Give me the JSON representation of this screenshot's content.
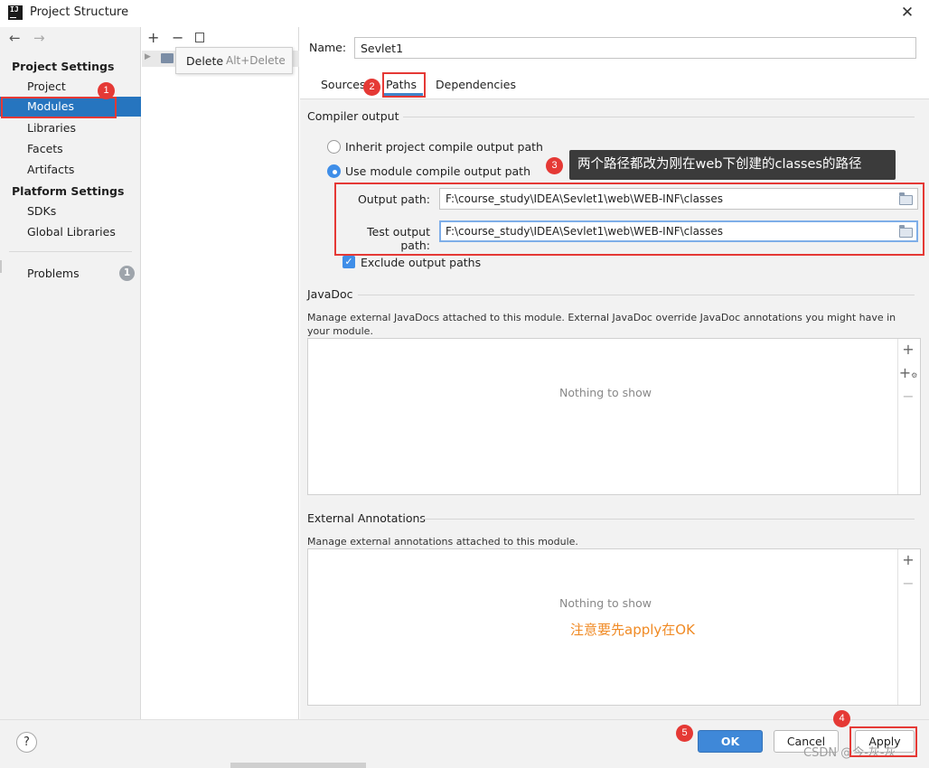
{
  "window": {
    "title": "Project Structure",
    "close_icon": "close-icon"
  },
  "sidebar": {
    "back_icon": "←",
    "forward_icon": "→",
    "project_settings_heading": "Project Settings",
    "project_settings_items": [
      "Project",
      "Modules",
      "Libraries",
      "Facets",
      "Artifacts"
    ],
    "selected_item": "Modules",
    "platform_settings_heading": "Platform Settings",
    "platform_settings_items": [
      "SDKs",
      "Global Libraries"
    ],
    "problems_label": "Problems",
    "problems_count": "1"
  },
  "module_list": {
    "add_icon": "+",
    "remove_icon": "−",
    "copy_icon": "copy-icon",
    "tooltip": {
      "label": "Delete",
      "shortcut": "Alt+Delete"
    }
  },
  "module": {
    "name_label": "Name:",
    "name_value": "Sevlet1",
    "tabs": [
      "Sources",
      "Paths",
      "Dependencies"
    ],
    "active_tab": "Paths",
    "compiler_output": {
      "title": "Compiler output",
      "option_inherit": "Inherit project compile output path",
      "option_module": "Use module compile output path",
      "selected_option": "module",
      "output_path_label": "Output path:",
      "output_path_value": "F:\\course_study\\IDEA\\Sevlet1\\web\\WEB-INF\\classes",
      "test_output_path_label": "Test output path:",
      "test_output_path_value": "F:\\course_study\\IDEA\\Sevlet1\\web\\WEB-INF\\classes",
      "exclude_label": "Exclude output paths",
      "exclude_checked": true
    },
    "javadoc": {
      "title": "JavaDoc",
      "description": "Manage external JavaDocs attached to this module. External JavaDoc override JavaDoc annotations you might have in your module.",
      "empty_text": "Nothing to show"
    },
    "external_annotations": {
      "title": "External Annotations",
      "description": "Manage external annotations attached to this module.",
      "empty_text": "Nothing to show"
    }
  },
  "buttons": {
    "help": "?",
    "ok": "OK",
    "cancel": "Cancel",
    "apply": "Apply"
  },
  "annotations": {
    "badges": [
      "1",
      "2",
      "3",
      "4",
      "5"
    ],
    "tip": "两个路径都改为刚在web下创建的classes的路径",
    "note": "注意要先apply在OK",
    "color": "#e53935"
  },
  "watermark": "CSDN @今-灰-灰"
}
